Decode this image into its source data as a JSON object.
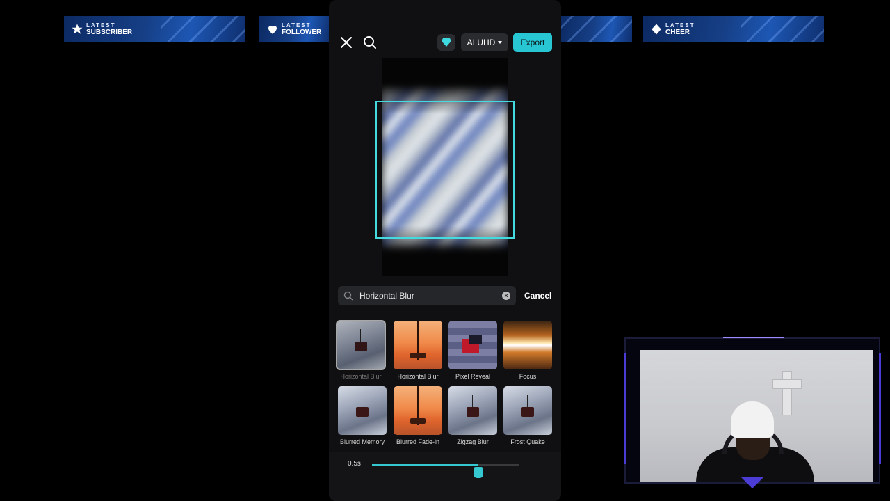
{
  "banners": [
    {
      "latest": "LATEST",
      "name": "SUBSCRIBER",
      "icon": "star-icon"
    },
    {
      "latest": "LATEST",
      "name": "FOLLOWER",
      "icon": "heart-icon"
    },
    {
      "latest": "LATEST",
      "name": "CHEER",
      "icon": "diamond-icon"
    }
  ],
  "editor": {
    "quality_label": "AI UHD",
    "export_label": "Export",
    "accent_color": "#27c6d2"
  },
  "search": {
    "value": "Horizontal Blur",
    "cancel_label": "Cancel"
  },
  "effects": [
    {
      "label": "Horizontal Blur",
      "selected": true
    },
    {
      "label": "Horizontal Blur",
      "selected": false
    },
    {
      "label": "Pixel Reveal",
      "selected": false
    },
    {
      "label": "Focus",
      "selected": false
    },
    {
      "label": "Blurred Memory",
      "selected": false
    },
    {
      "label": "Blurred Fade-in",
      "selected": false
    },
    {
      "label": "Zigzag Blur",
      "selected": false
    },
    {
      "label": "Frost Quake",
      "selected": false
    }
  ],
  "duration": {
    "label": "0.5s",
    "slider_fraction": 0.72
  }
}
